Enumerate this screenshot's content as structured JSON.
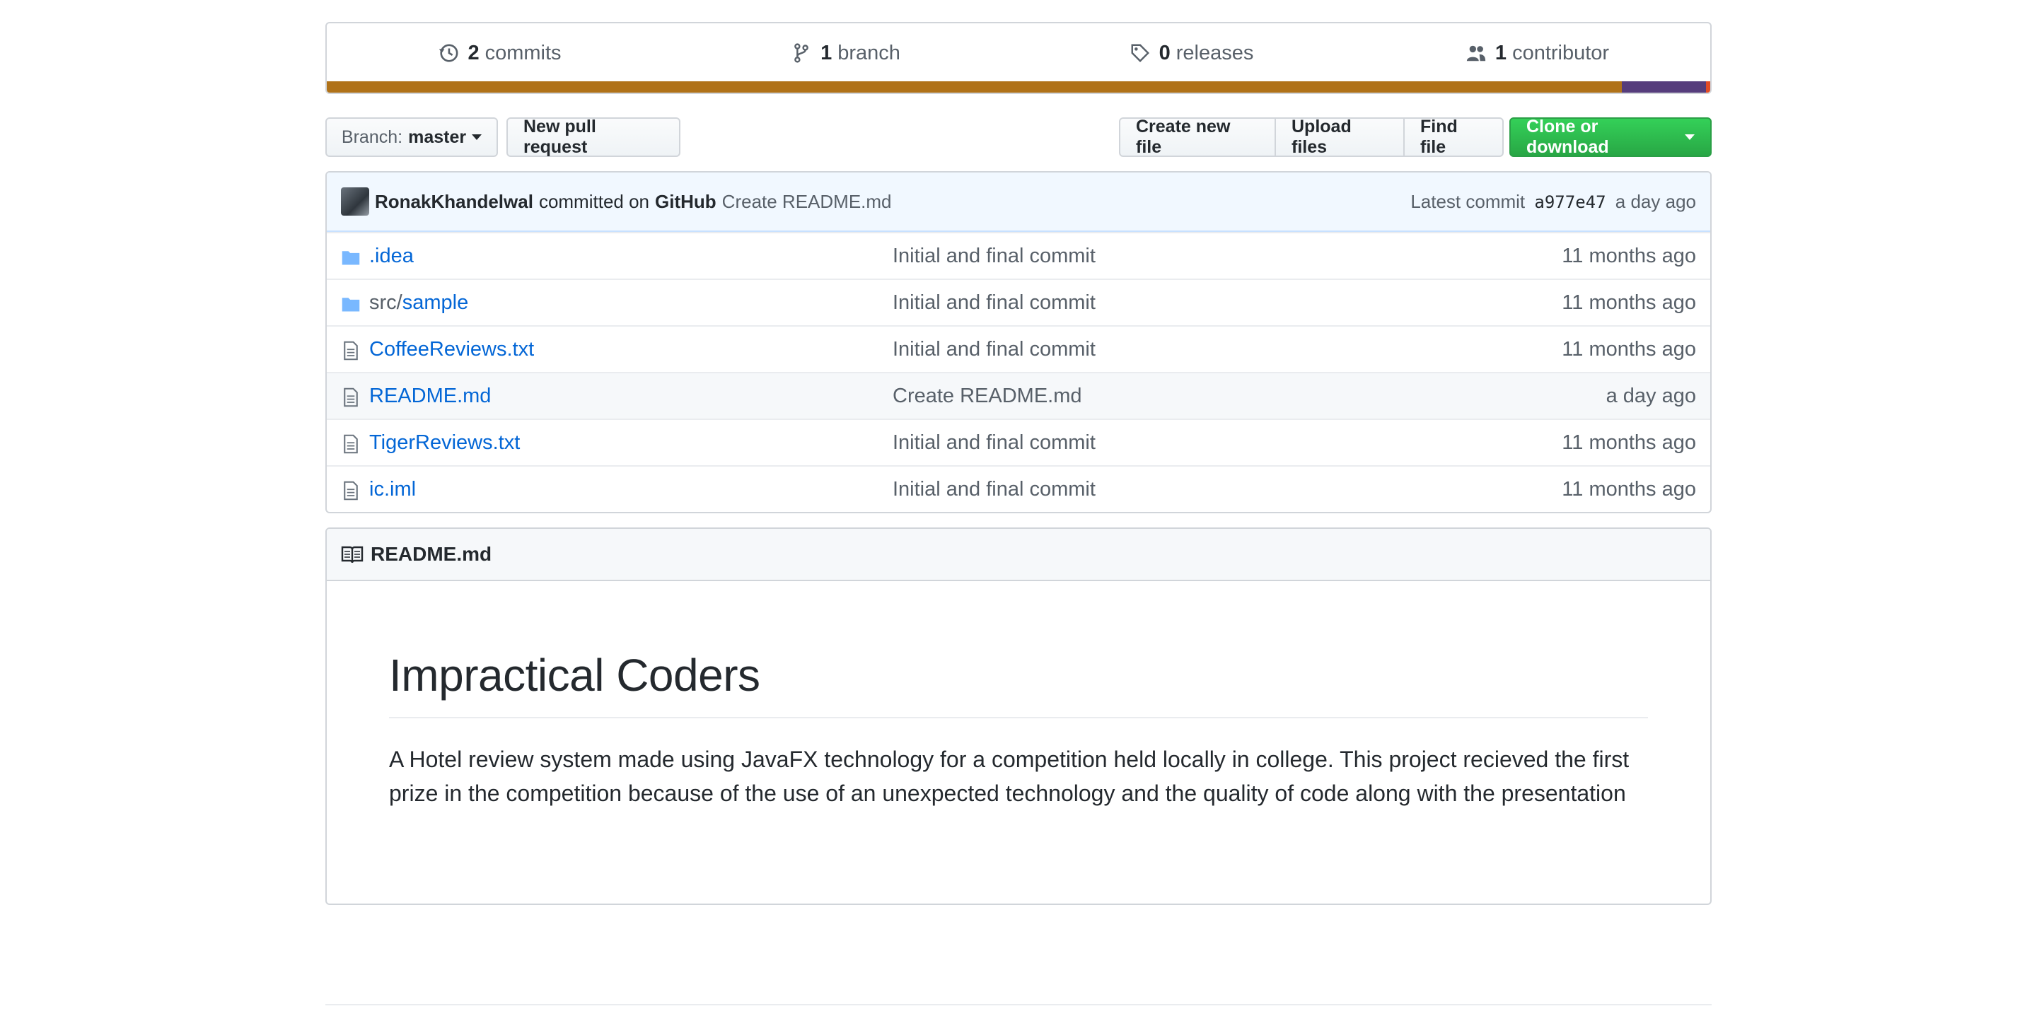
{
  "summary": {
    "commits_count": "2",
    "commits_label": "commits",
    "branch_count": "1",
    "branch_label": "branch",
    "releases_count": "0",
    "releases_label": "releases",
    "contributors_count": "1",
    "contributors_label": "contributor",
    "language_colors": [
      "#b07219",
      "#563d7c",
      "#e34c26"
    ]
  },
  "toolbar": {
    "branch_prefix": "Branch:",
    "branch_name": "master",
    "new_pull_request": "New pull request",
    "create_new_file": "Create new file",
    "upload_files": "Upload files",
    "find_file": "Find file",
    "clone_or_download": "Clone or download"
  },
  "latest_commit": {
    "author": "RonakKhandelwal",
    "committed_on": "committed on",
    "platform": "GitHub",
    "message": "Create README.md",
    "latest_label": "Latest commit",
    "sha": "a977e47",
    "age": "a day ago"
  },
  "files": [
    {
      "type": "folder-icon",
      "prefix": "",
      "name": ".idea",
      "message": "Initial and final commit",
      "age": "11 months ago"
    },
    {
      "type": "folder-icon",
      "prefix": "src/",
      "name": "sample",
      "message": "Initial and final commit",
      "age": "11 months ago"
    },
    {
      "type": "file-icon",
      "prefix": "",
      "name": "CoffeeReviews.txt",
      "message": "Initial and final commit",
      "age": "11 months ago"
    },
    {
      "type": "file-icon",
      "prefix": "",
      "name": "README.md",
      "message": "Create README.md",
      "age": "a day ago"
    },
    {
      "type": "file-icon",
      "prefix": "",
      "name": "TigerReviews.txt",
      "message": "Initial and final commit",
      "age": "11 months ago"
    },
    {
      "type": "file-icon",
      "prefix": "",
      "name": "ic.iml",
      "message": "Initial and final commit",
      "age": "11 months ago"
    }
  ],
  "readme": {
    "filename": "README.md",
    "title": "Impractical Coders",
    "description": "A Hotel review system made using JavaFX technology for a competition held locally in college. This project recieved the first prize in the competition because of the use of an unexpected technology and the quality of code along with the presentation"
  }
}
